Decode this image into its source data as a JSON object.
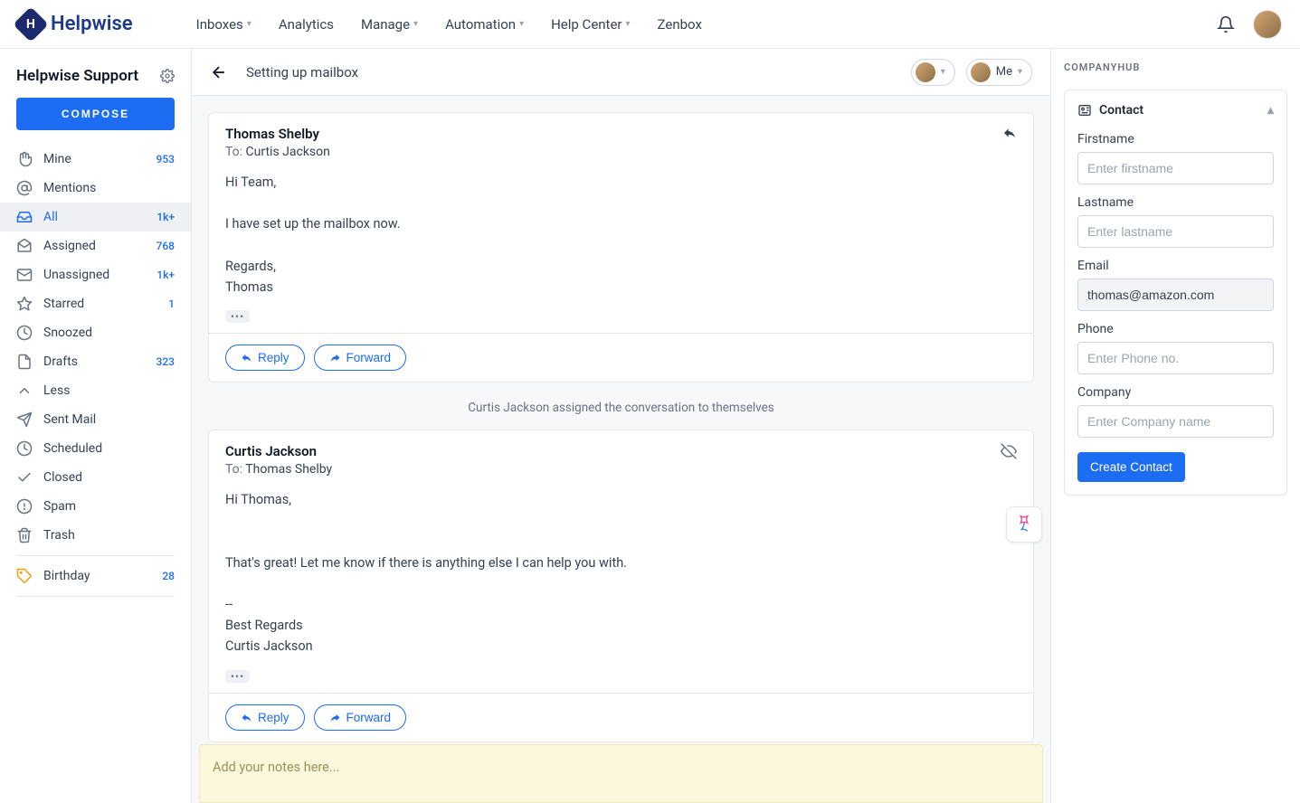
{
  "brand": "Helpwise",
  "nav": {
    "items": [
      {
        "label": "Inboxes",
        "dropdown": true
      },
      {
        "label": "Analytics",
        "dropdown": false
      },
      {
        "label": "Manage",
        "dropdown": true
      },
      {
        "label": "Automation",
        "dropdown": true
      },
      {
        "label": "Help Center",
        "dropdown": true
      },
      {
        "label": "Zenbox",
        "dropdown": false
      }
    ]
  },
  "sidebar": {
    "title": "Helpwise Support",
    "compose": "COMPOSE",
    "items": [
      {
        "icon": "hand",
        "label": "Mine",
        "count": "953"
      },
      {
        "icon": "at",
        "label": "Mentions",
        "count": ""
      },
      {
        "icon": "inbox",
        "label": "All",
        "count": "1k+",
        "active": true
      },
      {
        "icon": "mail-open",
        "label": "Assigned",
        "count": "768"
      },
      {
        "icon": "mail",
        "label": "Unassigned",
        "count": "1k+"
      },
      {
        "icon": "star",
        "label": "Starred",
        "count": "1"
      },
      {
        "icon": "clock",
        "label": "Snoozed",
        "count": ""
      },
      {
        "icon": "file",
        "label": "Drafts",
        "count": "323"
      },
      {
        "icon": "chevron-up",
        "label": "Less",
        "count": ""
      },
      {
        "icon": "send",
        "label": "Sent Mail",
        "count": ""
      },
      {
        "icon": "clock",
        "label": "Scheduled",
        "count": ""
      },
      {
        "icon": "check",
        "label": "Closed",
        "count": ""
      },
      {
        "icon": "alert",
        "label": "Spam",
        "count": ""
      },
      {
        "icon": "trash",
        "label": "Trash",
        "count": ""
      }
    ],
    "tag": {
      "label": "Birthday",
      "count": "28"
    }
  },
  "conversation": {
    "title": "Setting up mailbox",
    "assignee_me": "Me",
    "messages": [
      {
        "from": "Thomas Shelby",
        "to_label": "To:",
        "to": "Curtis Jackson",
        "body": "Hi Team,\n\nI have set up the mailbox now.\n\nRegards,\nThomas",
        "reply": "Reply",
        "forward": "Forward"
      },
      {
        "from": "Curtis Jackson",
        "to_label": "To:",
        "to": "Thomas Shelby",
        "body": "Hi Thomas,\n\n\nThat's great! Let me know if there is anything else I can help you with.\n\n--\nBest Regards\nCurtis Jackson",
        "reply": "Reply",
        "forward": "Forward"
      }
    ],
    "system_event": "Curtis Jackson assigned the conversation to themselves",
    "notes_placeholder": "Add your notes here..."
  },
  "rpanel": {
    "title": "COMPANYHUB",
    "contact_header": "Contact",
    "fields": {
      "firstname": {
        "label": "Firstname",
        "placeholder": "Enter firstname",
        "value": ""
      },
      "lastname": {
        "label": "Lastname",
        "placeholder": "Enter lastname",
        "value": ""
      },
      "email": {
        "label": "Email",
        "placeholder": "",
        "value": "thomas@amazon.com"
      },
      "phone": {
        "label": "Phone",
        "placeholder": "Enter Phone no.",
        "value": ""
      },
      "company": {
        "label": "Company",
        "placeholder": "Enter Company name",
        "value": ""
      }
    },
    "create_button": "Create Contact"
  }
}
